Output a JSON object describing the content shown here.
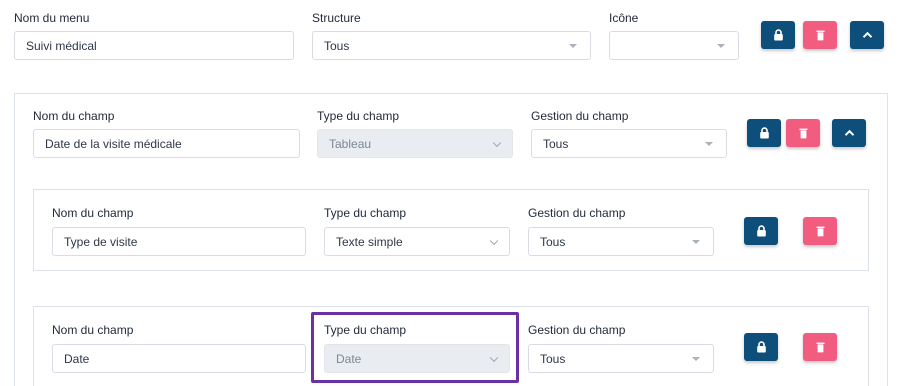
{
  "menu": {
    "name_label": "Nom du menu",
    "name_value": "Suivi médical",
    "structure_label": "Structure",
    "structure_value": "Tous",
    "icon_label": "Icône",
    "icon_value": ""
  },
  "field_group": {
    "name_label": "Nom du champ",
    "name_value": "Date de la visite médicale",
    "type_label": "Type du champ",
    "type_value": "Tableau",
    "management_label": "Gestion du champ",
    "management_value": "Tous"
  },
  "subfields": [
    {
      "name_label": "Nom du champ",
      "name_value": "Type de visite",
      "type_label": "Type du champ",
      "type_value": "Texte simple",
      "management_label": "Gestion du champ",
      "management_value": "Tous"
    },
    {
      "name_label": "Nom du champ",
      "name_value": "Date",
      "type_label": "Type du champ",
      "type_value": "Date",
      "management_label": "Gestion du champ",
      "management_value": "Tous"
    }
  ],
  "icons": {
    "lock": "lock-icon",
    "delete": "trash-icon",
    "collapse": "chevron-up-icon"
  },
  "colors": {
    "primary_button": "#0d4e7a",
    "delete_button": "#f25c7f",
    "highlight_border": "#6a31a4"
  }
}
